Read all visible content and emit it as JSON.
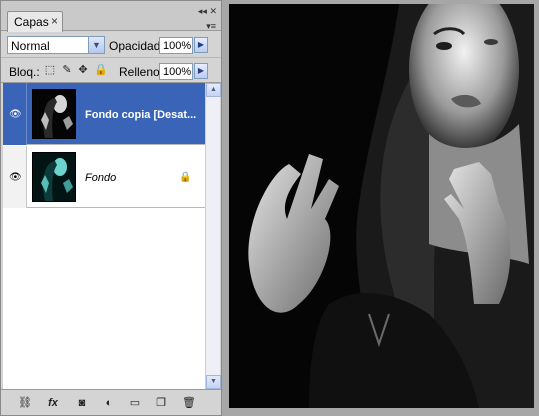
{
  "panel": {
    "tab_label": "Capas",
    "tab_close": "×",
    "blend_mode": "Normal",
    "opacity_label": "Opacidad:",
    "opacity_value": "100%",
    "lock_label": "Bloq.:",
    "fill_label": "Relleno:",
    "fill_value": "100%"
  },
  "layers": [
    {
      "name": "Fondo copia [Desat...",
      "selected": true,
      "italic": false
    },
    {
      "name": "Fondo",
      "selected": false,
      "italic": true,
      "locked": true
    }
  ],
  "footer_icons": [
    "link-icon",
    "fx-icon",
    "layer-mask-icon",
    "adjustment-layer-icon",
    "group-icon",
    "new-layer-icon",
    "trash-icon"
  ],
  "colors": {
    "selection": "#3a64b7",
    "panel_bg": "#d4d4d4",
    "workspace_bg": "#a7a7a7"
  }
}
